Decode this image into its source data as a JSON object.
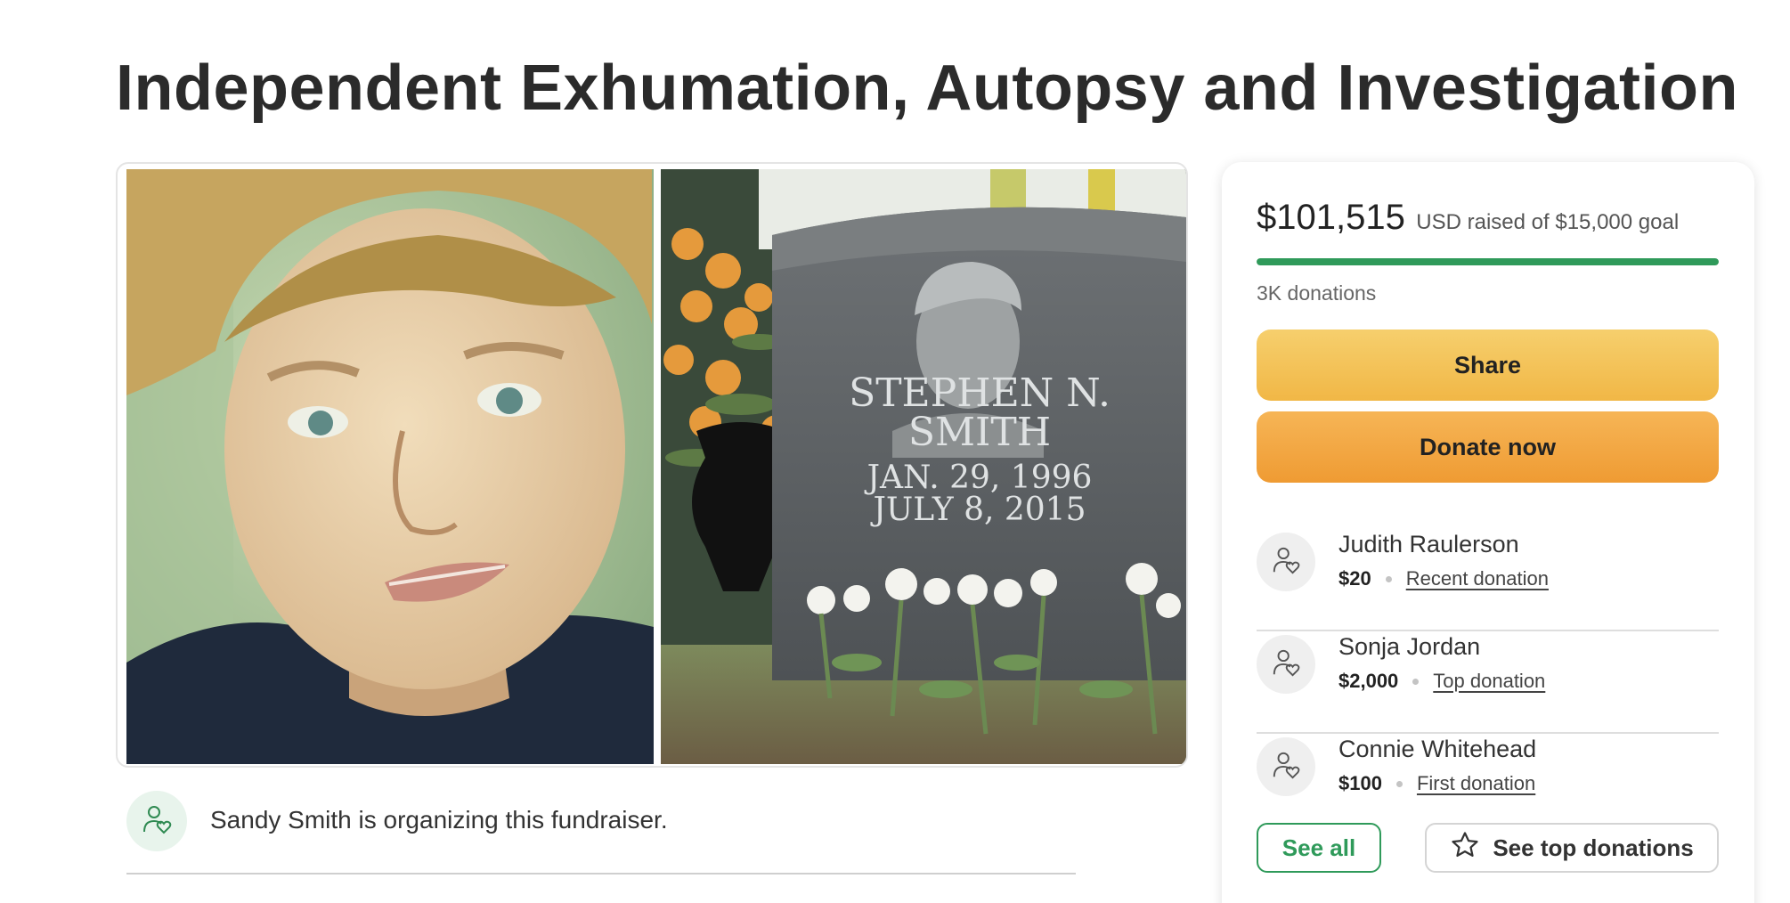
{
  "campaign": {
    "title": "Independent Exhumation, Autopsy and Investigation",
    "headstone": {
      "name_line1": "STEPHEN N.",
      "name_line2": "SMITH",
      "date_line1": "JAN. 29, 1996",
      "date_line2": "JULY 8, 2015"
    },
    "organizer_text": "Sandy Smith is organizing this fundraiser."
  },
  "donation_card": {
    "amount": "$101,515",
    "raised_text": "USD raised of $15,000 goal",
    "progress_fraction": 1.0,
    "donation_count": "3K donations",
    "share_label": "Share",
    "donate_label": "Donate now",
    "donors": [
      {
        "name": "Judith Raulerson",
        "amount": "$20",
        "tag": "Recent donation"
      },
      {
        "name": "Sonja Jordan",
        "amount": "$2,000",
        "tag": "Top donation"
      },
      {
        "name": "Connie Whitehead",
        "amount": "$100",
        "tag": "First donation"
      }
    ],
    "see_all_label": "See all",
    "see_top_label": "See top donations"
  },
  "colors": {
    "accent_green": "#2f9a5a",
    "share_yellow": "#f1b746",
    "donate_orange": "#ef9b33"
  },
  "icons": {
    "donor_avatar": "person-heart-icon",
    "see_top": "star-icon"
  }
}
